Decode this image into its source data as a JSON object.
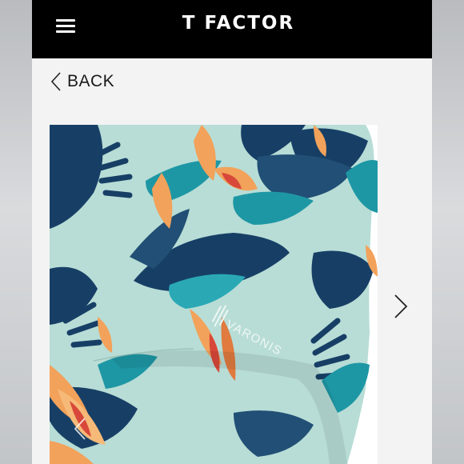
{
  "header": {
    "brand": "T FACTOR",
    "menu_icon": "hamburger-menu-icon"
  },
  "nav": {
    "back_label": "BACK",
    "back_icon": "chevron-left-icon",
    "next_icon": "chevron-right-icon"
  },
  "product": {
    "image_logo_text": "VARONIS",
    "pattern_colors": {
      "base": "#b8ddd6",
      "navy": "#173f66",
      "teal": "#1e97a5",
      "orange": "#f2a25a",
      "red": "#d8483a"
    }
  }
}
